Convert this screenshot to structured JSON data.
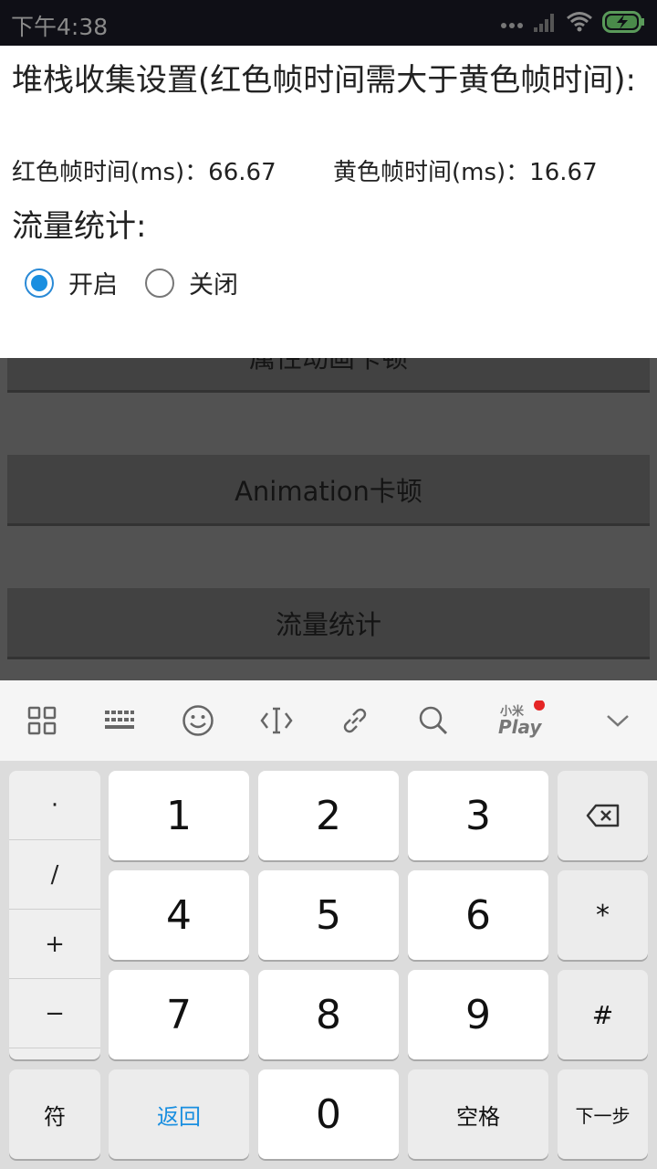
{
  "status_bar": {
    "time": "下午4:38"
  },
  "background": {
    "buttons": [
      "属性动画卡顿",
      "Animation卡顿",
      "流量统计"
    ]
  },
  "dialog": {
    "title": "堆栈收集设置(红色帧时间需大于黄色帧时间):",
    "red_frame_label": "红色帧时间(ms)：",
    "red_frame_value": "66.67",
    "yellow_frame_label": "黄色帧时间(ms)：",
    "yellow_frame_value": "16.67",
    "traffic_label": "流量统计:",
    "radio_on": "开启",
    "radio_off": "关闭",
    "selected": "开启"
  },
  "keyboard": {
    "toolbar_icons": [
      "grid-icon",
      "keyboard-icon",
      "emoji-icon",
      "cursor-icon",
      "link-icon",
      "search-icon",
      "mi-play-icon",
      "collapse-icon"
    ],
    "play_logo_text": "小米Play",
    "symbols": [
      "·",
      "/",
      "+",
      "−"
    ],
    "digits": [
      "1",
      "2",
      "3",
      "4",
      "5",
      "6",
      "7",
      "8",
      "9",
      "0"
    ],
    "star": "*",
    "hash": "#",
    "fu": "符",
    "back": "返回",
    "space": "空格",
    "next": "下一步"
  },
  "colors": {
    "accent": "#1a8fe0",
    "notification_dot": "#e52525"
  }
}
